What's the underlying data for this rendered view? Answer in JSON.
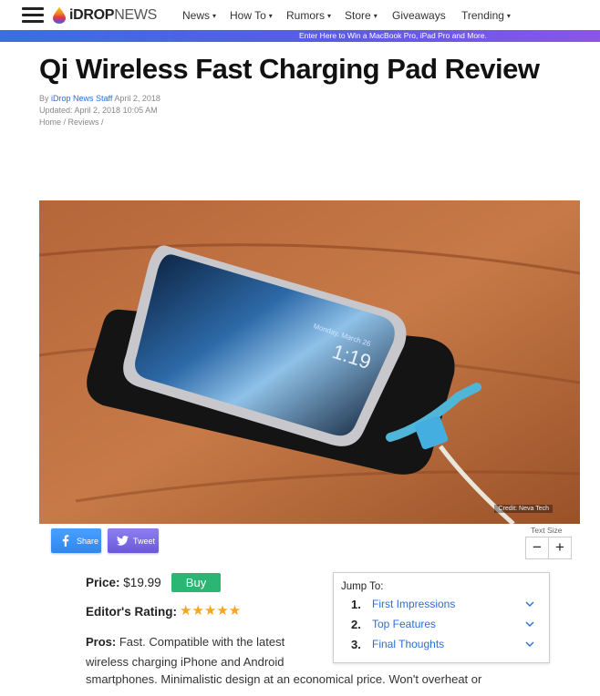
{
  "nav": {
    "logo_bold": "iDROP",
    "logo_light": "NEWS",
    "items": [
      "News",
      "How To",
      "Rumors",
      "Store",
      "Giveaways",
      "Trending"
    ],
    "caret": "▾"
  },
  "promo": {
    "text": "Enter Here to Win a MacBook Pro, iPad Pro and More."
  },
  "article": {
    "title": "Qi Wireless Fast Charging Pad Review",
    "by_prefix": "By",
    "author": "iDrop News Staff",
    "date": "April 2, 2018",
    "updated": "Updated: April 2, 2018 10:05 AM",
    "breadcrumb": "Home / Reviews /",
    "image_credit": "Credit: Neva Tech",
    "phone_lock_time": "1:19",
    "phone_lock_date": "Monday, March 26"
  },
  "share": {
    "facebook_label": "Share",
    "twitter_label": "Tweet"
  },
  "text_size": {
    "label": "Text Size",
    "minus": "−",
    "plus": "+"
  },
  "price": {
    "label": "Price:",
    "value": "$19.99",
    "buy_label": "Buy"
  },
  "rating": {
    "label": "Editor's Rating:",
    "stars_text": "★★★★★",
    "stars": 5
  },
  "jump_to": {
    "title": "Jump To:",
    "items": [
      {
        "num": "1.",
        "label": "First Impressions"
      },
      {
        "num": "2.",
        "label": "Top Features"
      },
      {
        "num": "3.",
        "label": "Final Thoughts"
      }
    ]
  },
  "pros": {
    "label": "Pros:",
    "text_part1": "Fast. Compatible with the latest wireless charging iPhone and Android",
    "text_part2": "smartphones. Minimalistic design at an economical price. Won't overheat or"
  },
  "colors": {
    "accent_link": "#2a6fd6",
    "buy_green": "#2bb673",
    "star_gold": "#f5a623",
    "facebook_blue": "#2e86f0",
    "twitter_purple": "#6b58de"
  }
}
